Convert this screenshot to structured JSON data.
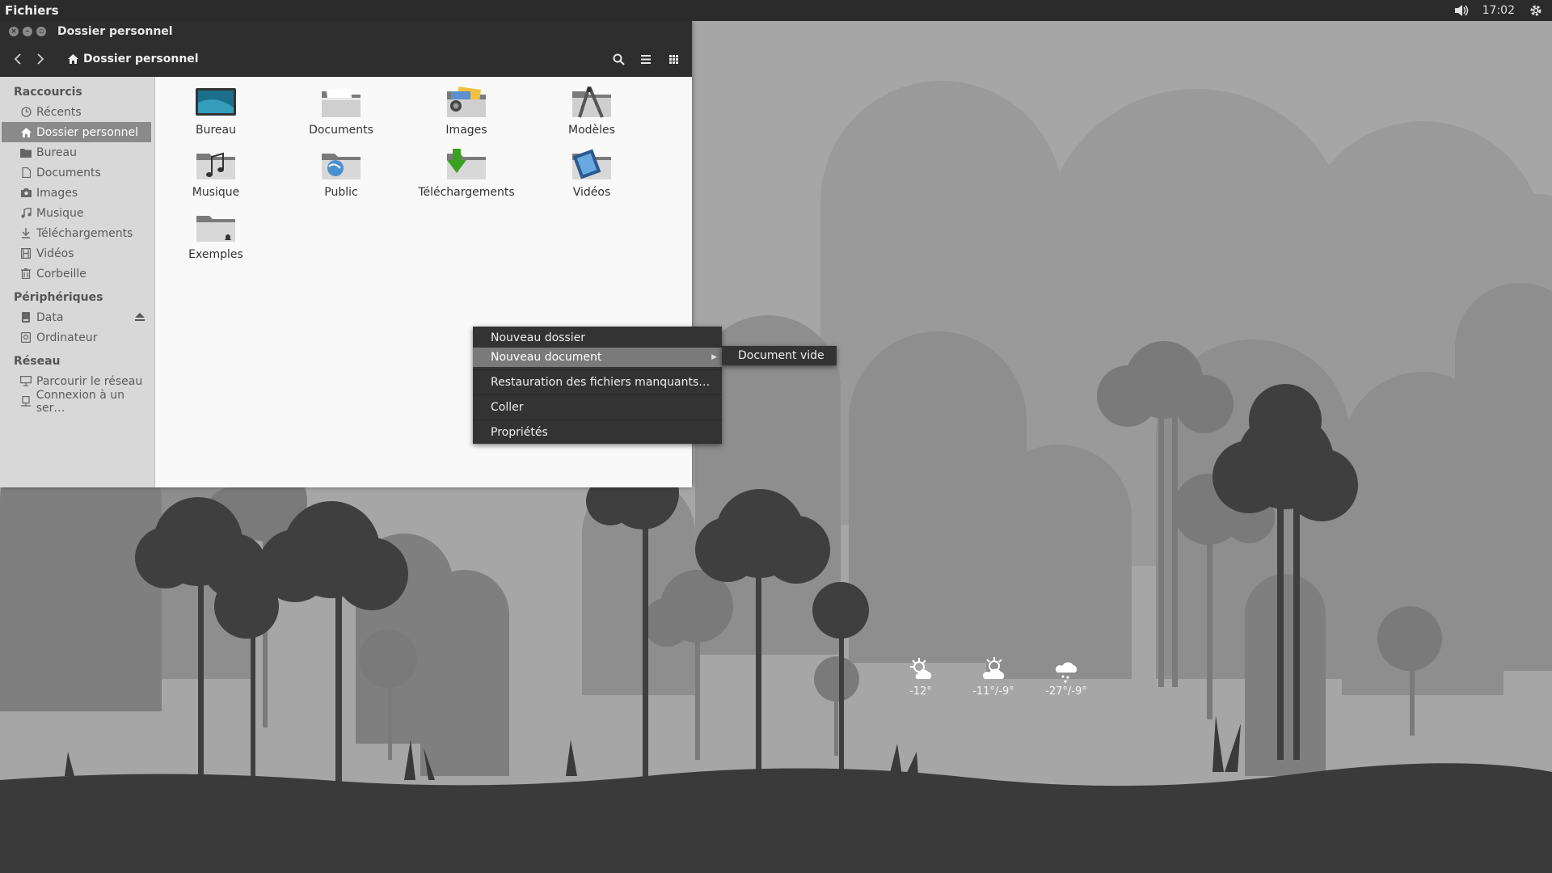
{
  "top_panel": {
    "app_name": "Fichiers",
    "clock": "17:02",
    "icons": [
      "volume-icon",
      "gear-icon"
    ]
  },
  "window": {
    "title": "Dossier personnel",
    "path_label": "Dossier personnel",
    "toolbar_icons": [
      "back-arrow-icon",
      "forward-arrow-icon",
      "search-icon",
      "list-view-icon",
      "grid-view-icon"
    ]
  },
  "sidebar": {
    "sections": [
      {
        "heading": "Raccourcis",
        "items": [
          {
            "label": "Récents",
            "icon": "clock-icon"
          },
          {
            "label": "Dossier personnel",
            "icon": "home-icon",
            "active": true
          },
          {
            "label": "Bureau",
            "icon": "folder-icon"
          },
          {
            "label": "Documents",
            "icon": "document-icon"
          },
          {
            "label": "Images",
            "icon": "camera-icon"
          },
          {
            "label": "Musique",
            "icon": "music-icon"
          },
          {
            "label": "Téléchargements",
            "icon": "download-icon"
          },
          {
            "label": "Vidéos",
            "icon": "film-icon"
          },
          {
            "label": "Corbeille",
            "icon": "trash-icon"
          }
        ]
      },
      {
        "heading": "Périphériques",
        "items": [
          {
            "label": "Data",
            "icon": "drive-icon"
          },
          {
            "label": "Ordinateur",
            "icon": "computer-icon"
          }
        ]
      },
      {
        "heading": "Réseau",
        "items": [
          {
            "label": "Parcourir le réseau",
            "icon": "network-icon"
          },
          {
            "label": "Connexion à un ser…",
            "icon": "server-icon"
          }
        ]
      }
    ]
  },
  "files": [
    {
      "label": "Bureau",
      "icon": "desktop-folder-icon"
    },
    {
      "label": "Documents",
      "icon": "documents-folder-icon"
    },
    {
      "label": "Images",
      "icon": "pictures-folder-icon"
    },
    {
      "label": "Modèles",
      "icon": "templates-folder-icon"
    },
    {
      "label": "Musique",
      "icon": "music-folder-icon"
    },
    {
      "label": "Public",
      "icon": "public-folder-icon"
    },
    {
      "label": "Téléchargements",
      "icon": "downloads-folder-icon"
    },
    {
      "label": "Vidéos",
      "icon": "videos-folder-icon"
    },
    {
      "label": "Exemples",
      "icon": "examples-folder-icon"
    }
  ],
  "context_menu": {
    "items": [
      "Nouveau dossier",
      "Nouveau document",
      "Restauration des fichiers manquants…",
      "Coller",
      "Propriétés"
    ],
    "submenu": [
      "Document vide"
    ]
  },
  "weather": [
    {
      "temp": "-12°",
      "icon": "sun-cloud-icon"
    },
    {
      "temp": "-11°/-9°",
      "icon": "sun-cloud-icon"
    },
    {
      "temp": "-27°/-9°",
      "icon": "snow-cloud-icon"
    }
  ],
  "colors": {
    "panel": "#2b2b2b",
    "window_header": "#2e2e2e",
    "sidebar": "#d8d8d8",
    "accent_selected": "#8a8a8a",
    "menu": "#333333"
  }
}
